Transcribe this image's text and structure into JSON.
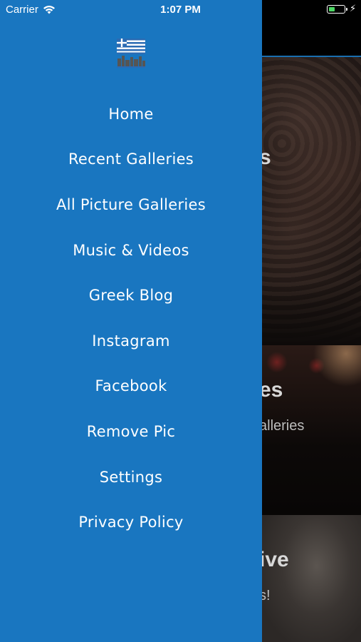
{
  "status_bar": {
    "carrier": "Carrier",
    "time": "1:07 PM",
    "battery_color": "#4cd964"
  },
  "drawer": {
    "background": "#1976c0",
    "logo_icon": "greek-flag-logo-icon",
    "menu": [
      {
        "label": "Home"
      },
      {
        "label": "Recent Galleries"
      },
      {
        "label": "All Picture Galleries"
      },
      {
        "label": "Music & Videos"
      },
      {
        "label": "Greek Blog"
      },
      {
        "label": "Instagram"
      },
      {
        "label": "Facebook"
      },
      {
        "label": "Remove Pic"
      },
      {
        "label": "Settings"
      },
      {
        "label": "Privacy Policy"
      }
    ]
  },
  "background_content": {
    "card1_title_fragment": "s",
    "card2_title_fragment": "es",
    "card2_sub_fragment": "alleries",
    "card3_title_fragment": "ive",
    "card3_sub_fragment": "s!"
  }
}
